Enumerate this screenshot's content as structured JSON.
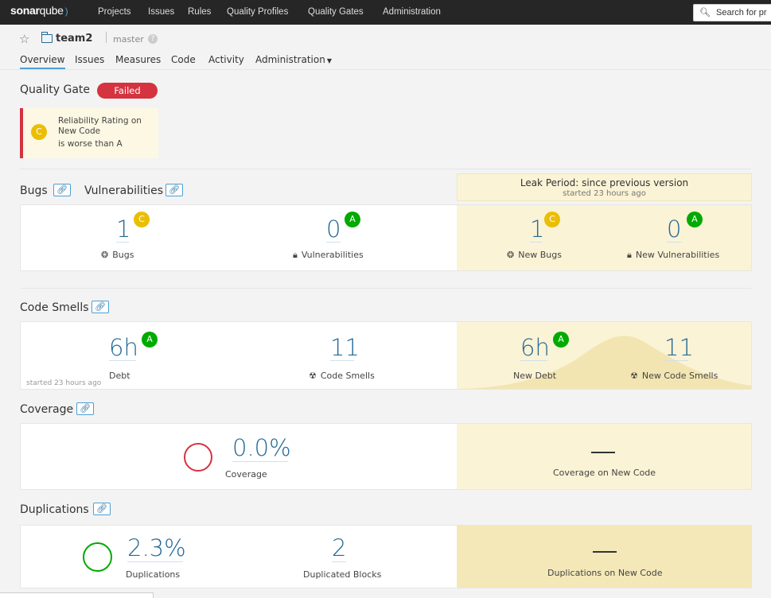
{
  "topnav": {
    "logo_bold": "sonar",
    "logo_rest": "qube",
    "links": [
      "Projects",
      "Issues",
      "Rules",
      "Quality Profiles",
      "Quality Gates",
      "Administration"
    ],
    "search_placeholder": "Search for pr"
  },
  "project": {
    "name": "team2",
    "branch": "master",
    "tabs": [
      "Overview",
      "Issues",
      "Measures",
      "Code",
      "Activity",
      "Administration"
    ]
  },
  "quality_gate": {
    "title": "Quality Gate",
    "status": "Failed",
    "condition": {
      "rating": "C",
      "line1": "Reliability Rating on",
      "line2": "New Code",
      "line3": "is worse than A"
    }
  },
  "leak_period": {
    "title": "Leak Period: since previous version",
    "subtitle": "started 23 hours ago"
  },
  "bugs_section": {
    "bugs_title": "Bugs",
    "vulns_title": "Vulnerabilities",
    "bugs": {
      "value": "1",
      "rating": "C",
      "label": "Bugs"
    },
    "vulns": {
      "value": "0",
      "rating": "A",
      "label": "Vulnerabilities"
    },
    "new_bugs": {
      "value": "1",
      "rating": "C",
      "label": "New Bugs"
    },
    "new_vulns": {
      "value": "0",
      "rating": "A",
      "label": "New Vulnerabilities"
    }
  },
  "code_smells": {
    "title": "Code Smells",
    "debt": {
      "value": "6h",
      "rating": "A",
      "label": "Debt"
    },
    "smells": {
      "value": "11",
      "label": "Code Smells"
    },
    "started": "started 23 hours ago",
    "new_debt": {
      "value": "6h",
      "rating": "A",
      "label": "New Debt"
    },
    "new_smells": {
      "value": "11",
      "label": "New Code Smells"
    }
  },
  "coverage": {
    "title": "Coverage",
    "value": "0.0%",
    "label": "Coverage",
    "new_label": "Coverage on New Code"
  },
  "duplications": {
    "title": "Duplications",
    "value": "2.3%",
    "label": "Duplications",
    "blocks_value": "2",
    "blocks_label": "Duplicated Blocks",
    "new_label": "Duplications on New Code"
  },
  "colors": {
    "accent": "#4b9fd5",
    "value_blue": "#236a97",
    "rating_a": "#00aa00",
    "rating_c": "#eabe06",
    "failed": "#d4333f",
    "leak_bg": "#fbf3d5"
  }
}
